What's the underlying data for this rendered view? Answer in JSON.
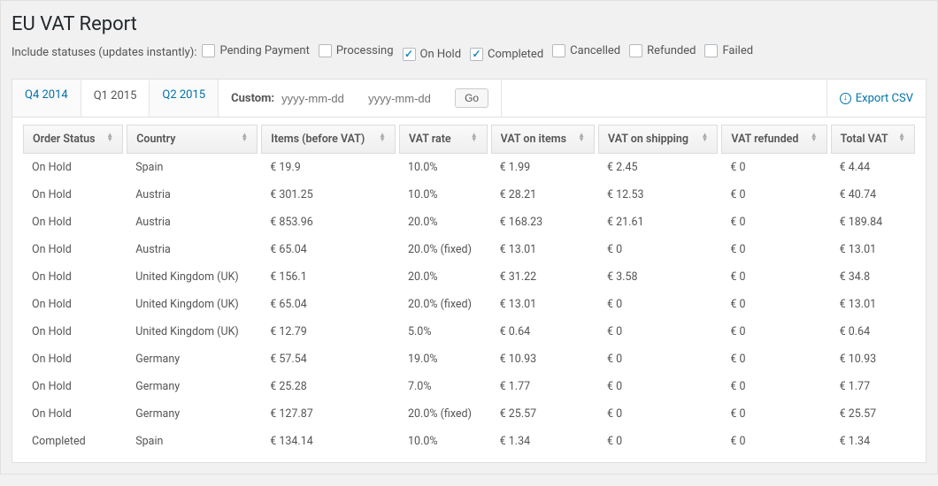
{
  "page_title": "EU VAT Report",
  "statuses": {
    "label": "Include statuses (updates instantly):",
    "options": [
      {
        "label": "Pending Payment",
        "checked": false
      },
      {
        "label": "Processing",
        "checked": false
      },
      {
        "label": "On Hold",
        "checked": true
      },
      {
        "label": "Completed",
        "checked": true
      },
      {
        "label": "Cancelled",
        "checked": false
      },
      {
        "label": "Refunded",
        "checked": false
      },
      {
        "label": "Failed",
        "checked": false
      }
    ]
  },
  "tabs": {
    "items": [
      {
        "label": "Q4 2014",
        "active": false
      },
      {
        "label": "Q1 2015",
        "active": true
      },
      {
        "label": "Q2 2015",
        "active": false
      }
    ],
    "custom_label": "Custom:",
    "date_placeholder": "yyyy-mm-dd",
    "go_label": "Go",
    "export_label": "Export CSV"
  },
  "table": {
    "columns": [
      "Order Status",
      "Country",
      "Items (before VAT)",
      "VAT rate",
      "VAT on items",
      "VAT on shipping",
      "VAT refunded",
      "Total VAT"
    ],
    "rows": [
      [
        "On Hold",
        "Spain",
        "€ 19.9",
        "10.0%",
        "€ 1.99",
        "€ 2.45",
        "€ 0",
        "€ 4.44"
      ],
      [
        "On Hold",
        "Austria",
        "€ 301.25",
        "10.0%",
        "€ 28.21",
        "€ 12.53",
        "€ 0",
        "€ 40.74"
      ],
      [
        "On Hold",
        "Austria",
        "€ 853.96",
        "20.0%",
        "€ 168.23",
        "€ 21.61",
        "€ 0",
        "€ 189.84"
      ],
      [
        "On Hold",
        "Austria",
        "€ 65.04",
        "20.0% (fixed)",
        "€ 13.01",
        "€ 0",
        "€ 0",
        "€ 13.01"
      ],
      [
        "On Hold",
        "United Kingdom (UK)",
        "€ 156.1",
        "20.0%",
        "€ 31.22",
        "€ 3.58",
        "€ 0",
        "€ 34.8"
      ],
      [
        "On Hold",
        "United Kingdom (UK)",
        "€ 65.04",
        "20.0% (fixed)",
        "€ 13.01",
        "€ 0",
        "€ 0",
        "€ 13.01"
      ],
      [
        "On Hold",
        "United Kingdom (UK)",
        "€ 12.79",
        "5.0%",
        "€ 0.64",
        "€ 0",
        "€ 0",
        "€ 0.64"
      ],
      [
        "On Hold",
        "Germany",
        "€ 57.54",
        "19.0%",
        "€ 10.93",
        "€ 0",
        "€ 0",
        "€ 10.93"
      ],
      [
        "On Hold",
        "Germany",
        "€ 25.28",
        "7.0%",
        "€ 1.77",
        "€ 0",
        "€ 0",
        "€ 1.77"
      ],
      [
        "On Hold",
        "Germany",
        "€ 127.87",
        "20.0% (fixed)",
        "€ 25.57",
        "€ 0",
        "€ 0",
        "€ 25.57"
      ],
      [
        "Completed",
        "Spain",
        "€ 134.14",
        "10.0%",
        "€ 1.34",
        "€ 0",
        "€ 0",
        "€ 1.34"
      ]
    ]
  }
}
